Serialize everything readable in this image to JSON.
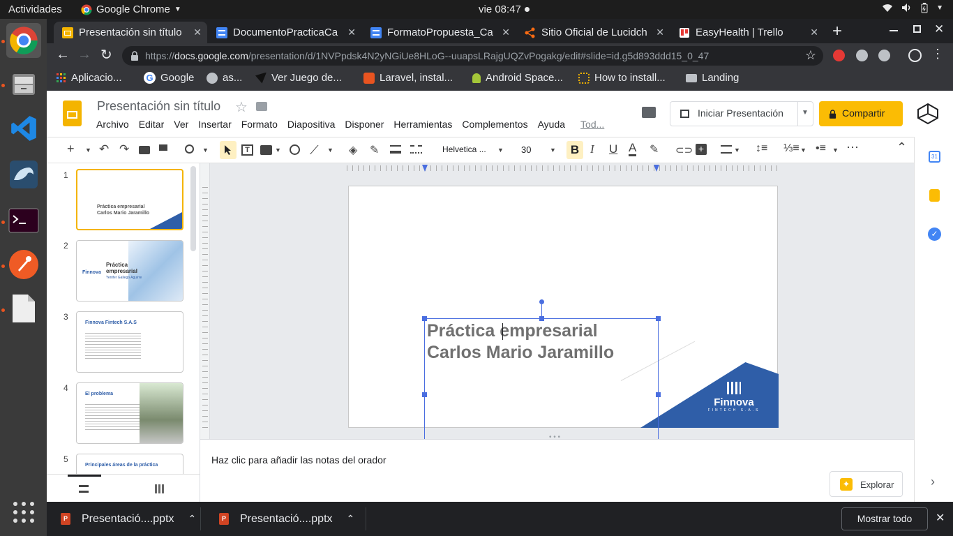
{
  "os": {
    "activities": "Actividades",
    "app_name": "Google Chrome",
    "clock": "vie 08:47"
  },
  "tabs": [
    {
      "title": "Presentación sin título",
      "icon": "slides-icon"
    },
    {
      "title": "DocumentoPracticaCa",
      "icon": "docs-icon"
    },
    {
      "title": "FormatoPropuesta_Ca",
      "icon": "docs-icon"
    },
    {
      "title": "Sitio Oficial de Lucidch",
      "icon": "lucidchart-icon"
    },
    {
      "title": "EasyHealth | Trello",
      "icon": "trello-icon"
    }
  ],
  "address": {
    "scheme": "https://",
    "domain": "docs.google.com",
    "path": "/presentation/d/1NVPpdsk4N2yNGiUe8HLoG--uuapsLRajgUQZvPogakg/edit#slide=id.g5d893ddd15_0_47"
  },
  "bookmarks": [
    "Aplicacio...",
    "Google",
    "as...",
    "Ver Juego de...",
    "Laravel, instal...",
    "Android Space...",
    "How to install...",
    "Landing"
  ],
  "docs": {
    "title": "Presentación sin título",
    "menu": [
      "Archivo",
      "Editar",
      "Ver",
      "Insertar",
      "Formato",
      "Diapositiva",
      "Disponer",
      "Herramientas",
      "Complementos",
      "Ayuda",
      "Tod..."
    ],
    "present_label": "Iniciar Presentación",
    "share_label": "Compartir"
  },
  "toolbar": {
    "font": "Helvetica ...",
    "size": "30"
  },
  "slides": [
    {
      "num": "1",
      "line1": "Práctica empresarial",
      "line2": "Carlos Mario Jaramillo"
    },
    {
      "num": "2",
      "title": "Práctica empresarial",
      "sub": "Yenifer Gallego Aguirre",
      "brand": "Finnova"
    },
    {
      "num": "3",
      "title": "Finnova Fintech S.A.S"
    },
    {
      "num": "4",
      "title": "El problema"
    },
    {
      "num": "5",
      "title": "Principales áreas de la práctica"
    }
  ],
  "main_slide": {
    "line1": "Práctica empresarial",
    "line2": "Carlos Mario Jaramillo",
    "brand": "Finnova",
    "brand_sub": "FINTECH S.A.S"
  },
  "notes_placeholder": "Haz clic para añadir las notas del orador",
  "explore_label": "Explorar",
  "downloads": [
    {
      "name": "Presentació....pptx"
    },
    {
      "name": "Presentació....pptx"
    }
  ],
  "show_all": "Mostrar todo",
  "colors": {
    "accent_blue": "#2f5ea8",
    "share_yellow": "#fbbc04",
    "selection_blue": "#4a6ee0",
    "ubuntu_orange": "#e95420"
  }
}
